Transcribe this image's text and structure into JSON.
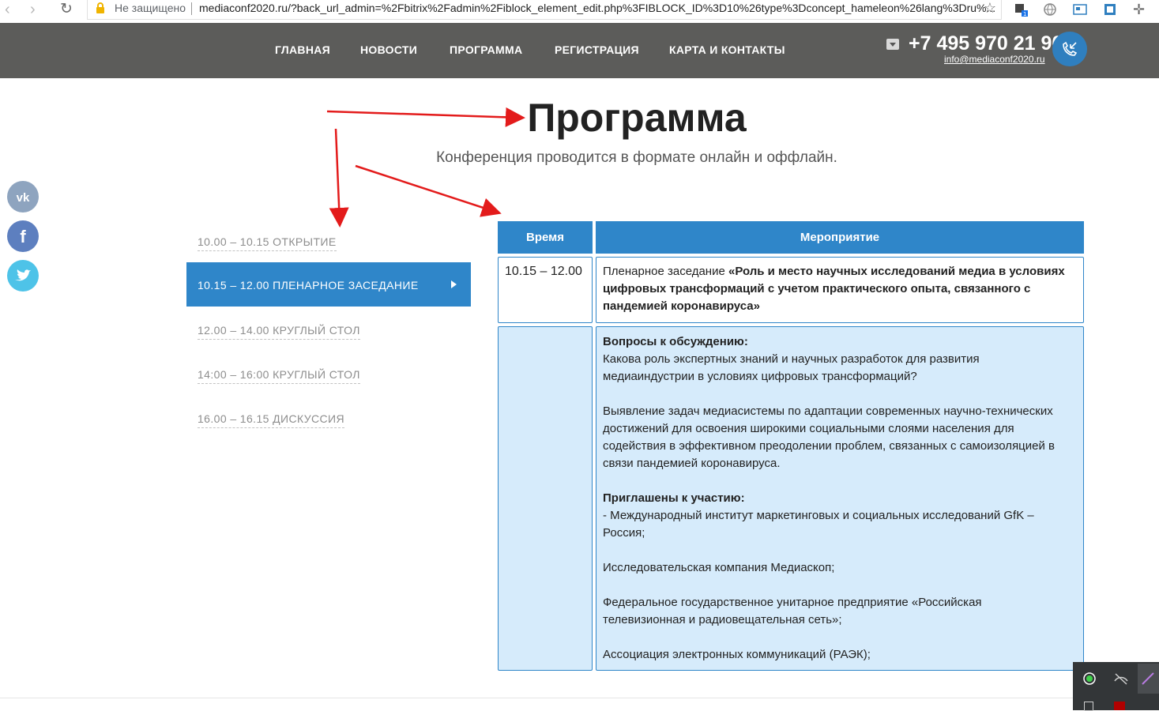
{
  "browser": {
    "not_secure": "Не защищено",
    "url": "mediaconf2020.ru/?back_url_admin=%2Fbitrix%2Fadmin%2Fiblock_element_edit.php%3FIBLOCK_ID%3D10%26type%3Dconcept_hameleon%26lang%3Dru%..."
  },
  "header": {
    "menu": [
      "ГЛАВНАЯ",
      "НОВОСТИ",
      "ПРОГРАММА",
      "РЕГИСТРАЦИЯ",
      "КАРТА И КОНТАКТЫ"
    ],
    "phone": "+7 495 970 21 90",
    "email": "info@mediaconf2020.ru"
  },
  "page": {
    "title": "Программа",
    "subtitle": "Конференция проводится в формате онлайн и оффлайн."
  },
  "schedule": {
    "items": [
      "10.00 – 10.15 ОТКРЫТИЕ",
      "10.15 – 12.00 ПЛЕНАРНОЕ ЗАСЕДАНИЕ",
      "12.00 – 14.00 КРУГЛЫЙ СТОЛ",
      "14:00 – 16:00 КРУГЛЫЙ СТОЛ",
      "16.00 – 16.15 ДИСКУССИЯ"
    ]
  },
  "table": {
    "head_time": "Время",
    "head_event": "Мероприятие",
    "row1_time": "10.15 – 12.00",
    "row1_prefix": "Пленарное заседание ",
    "row1_bold": "«Роль и место научных исследований медиа в условиях цифровых трансформаций с учетом практического опыта, связанного с пандемией коронавируса»",
    "questions_head": "Вопросы к обсуждению:",
    "q1": "Какова роль экспертных знаний и научных разработок для развития медиаиндустрии в условиях цифровых трансформаций?",
    "q2": "Выявление задач медиасистемы по адаптации современных научно-технических достижений для освоения широкими социальными слоями населения для содействия в эффективном преодолении проблем, связанных с самоизоляцией в связи пандемией коронавируса.",
    "invited_head": "Приглашены к участию:",
    "inv1": "- Международный институт маркетинговых и социальных исследований GfK – Россия;",
    "inv2": "Исследовательская компания Медиаскоп;",
    "inv3": "Федеральное государственное унитарное предприятие «Российская телевизионная и радиовещательная сеть»;",
    "inv4": "Ассоциация электронных коммуникаций (РАЭК);"
  },
  "colors": {
    "accent": "#2f86c9",
    "header_bg": "#5c5c5a",
    "cell_bg": "#d6ebfb",
    "annotation": "#e31b1b"
  }
}
